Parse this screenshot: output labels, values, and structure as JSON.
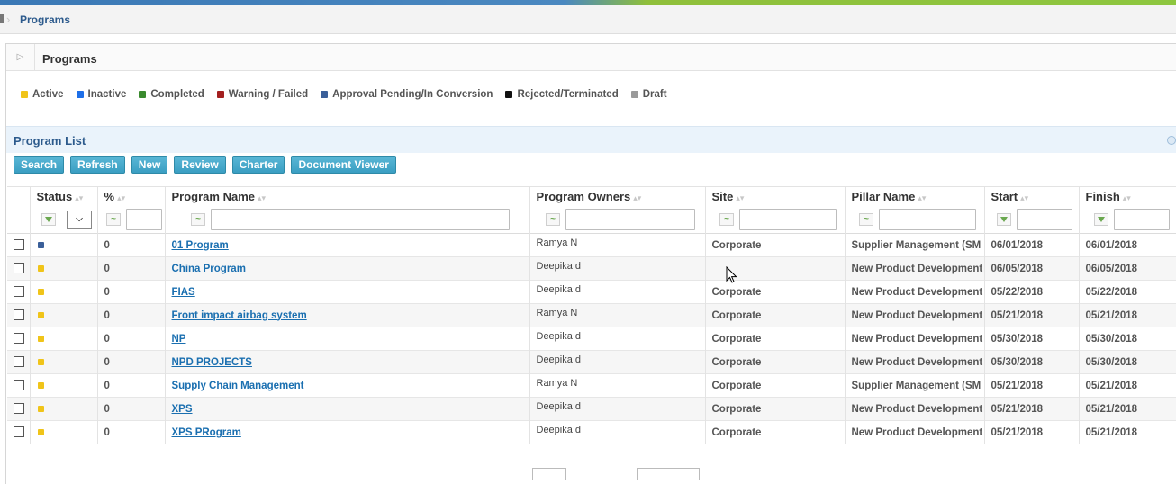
{
  "breadcrumb": {
    "current": "Programs"
  },
  "panel": {
    "title": "Programs"
  },
  "legend": [
    {
      "label": "Active",
      "color": "#f0c419"
    },
    {
      "label": "Inactive",
      "color": "#1e6fe8"
    },
    {
      "label": "Completed",
      "color": "#3a8a2e"
    },
    {
      "label": "Warning / Failed",
      "color": "#a31f1f"
    },
    {
      "label": "Approval Pending/In Conversion",
      "color": "#3a5f99"
    },
    {
      "label": "Rejected/Terminated",
      "color": "#111111"
    },
    {
      "label": "Draft",
      "color": "#9a9a9a"
    }
  ],
  "list": {
    "title": "Program List"
  },
  "toolbar": {
    "search": "Search",
    "refresh": "Refresh",
    "new": "New",
    "review": "Review",
    "charter": "Charter",
    "document_viewer": "Document Viewer"
  },
  "columns": {
    "status": "Status",
    "percent": "%",
    "program_name": "Program Name",
    "program_owners": "Program Owners",
    "site": "Site",
    "pillar_name": "Pillar Name",
    "start": "Start",
    "finish": "Finish"
  },
  "status_colors": {
    "approval": "#3a5f99",
    "active": "#f0c419"
  },
  "rows": [
    {
      "status": "approval",
      "percent": "0",
      "name": "01 Program",
      "owner": "Ramya N",
      "site": "Corporate",
      "pillar": "Supplier Management (SM",
      "start": "06/01/2018",
      "finish": "06/01/2018"
    },
    {
      "status": "active",
      "percent": "0",
      "name": "China Program",
      "owner": "Deepika d",
      "site": "",
      "pillar": "New Product Development",
      "start": "06/05/2018",
      "finish": "06/05/2018"
    },
    {
      "status": "active",
      "percent": "0",
      "name": "FIAS",
      "owner": "Deepika d",
      "site": "Corporate",
      "pillar": "New Product Development",
      "start": "05/22/2018",
      "finish": "05/22/2018"
    },
    {
      "status": "active",
      "percent": "0",
      "name": "Front impact airbag system",
      "owner": "Ramya N",
      "site": "Corporate",
      "pillar": "New Product Development",
      "start": "05/21/2018",
      "finish": "05/21/2018"
    },
    {
      "status": "active",
      "percent": "0",
      "name": "NP",
      "owner": "Deepika d",
      "site": "Corporate",
      "pillar": "New Product Development",
      "start": "05/30/2018",
      "finish": "05/30/2018"
    },
    {
      "status": "active",
      "percent": "0",
      "name": "NPD PROJECTS",
      "owner": "Deepika d",
      "site": "Corporate",
      "pillar": "New Product Development",
      "start": "05/30/2018",
      "finish": "05/30/2018"
    },
    {
      "status": "active",
      "percent": "0",
      "name": "Supply Chain Management",
      "owner": "Ramya N",
      "site": "Corporate",
      "pillar": "Supplier Management (SM",
      "start": "05/21/2018",
      "finish": "05/21/2018"
    },
    {
      "status": "active",
      "percent": "0",
      "name": "XPS ",
      "owner": "Deepika d",
      "site": "Corporate",
      "pillar": "New Product Development",
      "start": "05/21/2018",
      "finish": "05/21/2018"
    },
    {
      "status": "active",
      "percent": "0",
      "name": "XPS PRogram",
      "owner": "Deepika d",
      "site": "Corporate",
      "pillar": "New Product Development",
      "start": "05/21/2018",
      "finish": "05/21/2018"
    }
  ]
}
